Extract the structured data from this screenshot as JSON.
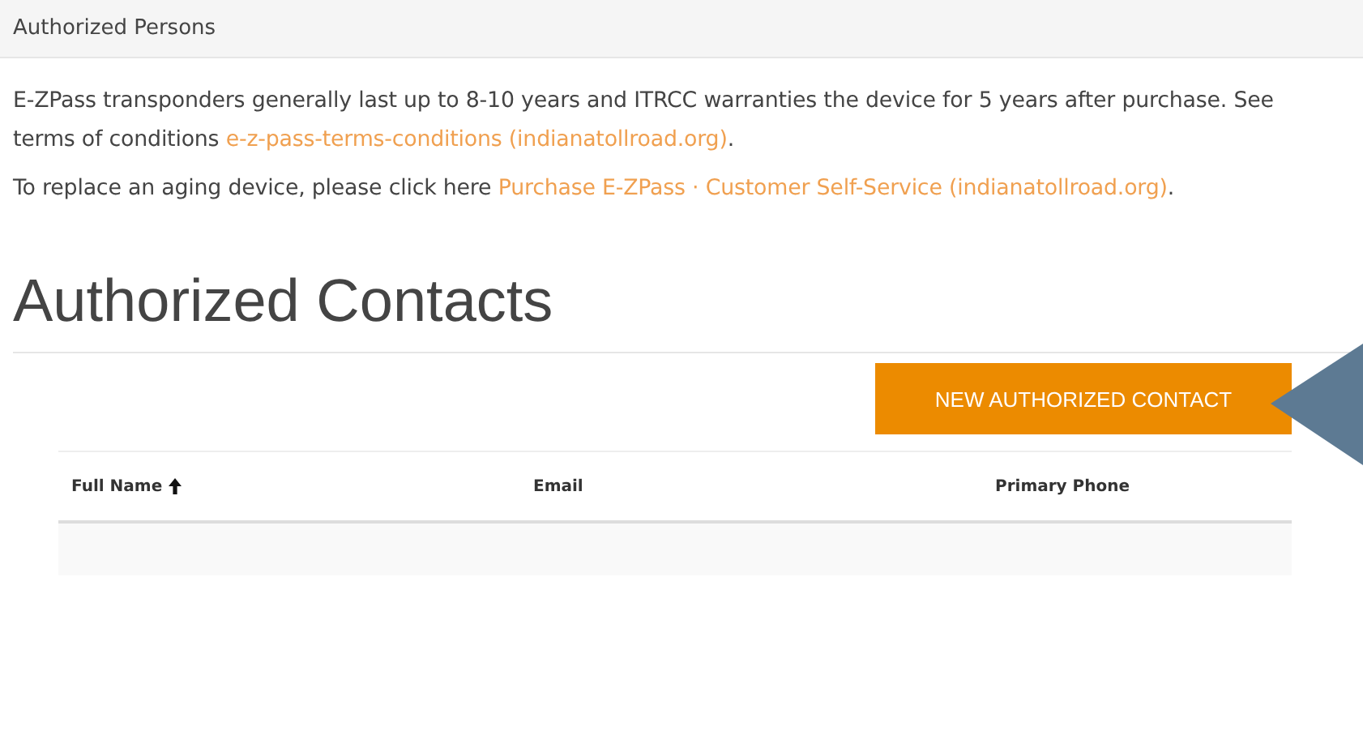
{
  "panel_title": "Authorized Persons",
  "notes": [
    {
      "text": "E-ZPass transponders generally last up to 8-10 years and ITRCC warranties the device for 5 years after purchase. See terms of conditions ",
      "link": "e-z-pass-terms-conditions (indianatollroad.org)",
      "after": "."
    },
    {
      "text": "To replace an aging device, please click here ",
      "link": "Purchase E-ZPass · Customer Self-Service (indianatollroad.org)",
      "after": "."
    }
  ],
  "heading": "Authorized Contacts",
  "new_button": "NEW AUTHORIZED CONTACT",
  "callout_arrow": true,
  "table": {
    "columns": [
      {
        "label": "Full Name",
        "sorted": true
      },
      {
        "label": "Email",
        "sorted": false
      },
      {
        "label": "Primary Phone",
        "sorted": false
      }
    ]
  }
}
